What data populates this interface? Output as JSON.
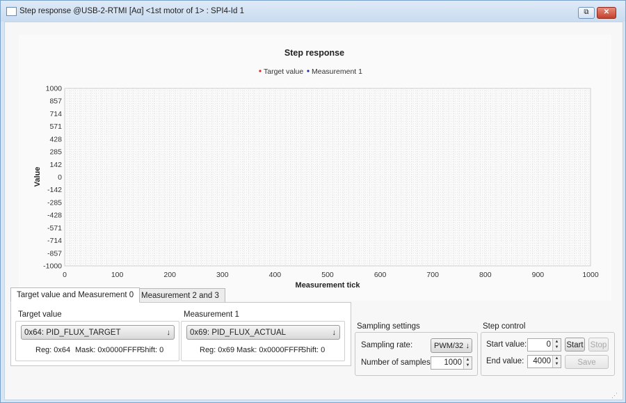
{
  "window": {
    "title": "Step response @USB-2-RTMI [Aα] <1st motor of 1> : SPI4-Id 1",
    "restore_glyph": "⧉",
    "close_glyph": "✕"
  },
  "chart_data": {
    "type": "line",
    "title": "Step response",
    "xlabel": "Measurement tick",
    "ylabel": "Value",
    "xlim": [
      0,
      1000
    ],
    "ylim": [
      -1000,
      1000
    ],
    "x_ticks": [
      "0",
      "100",
      "200",
      "300",
      "400",
      "500",
      "600",
      "700",
      "800",
      "900",
      "1000"
    ],
    "y_ticks": [
      "1000",
      "857",
      "714",
      "571",
      "428",
      "285",
      "142",
      "0",
      "-142",
      "-285",
      "-428",
      "-571",
      "-714",
      "-857",
      "-1000"
    ],
    "grid": true,
    "legend_position": "top-center",
    "series": [
      {
        "name": "Target value",
        "color": "#d62728",
        "values": []
      },
      {
        "name": "Measurement 1",
        "color": "#1f2f9f",
        "values": []
      }
    ]
  },
  "tabs": [
    {
      "label": "Target value and Measurement 0",
      "active": true
    },
    {
      "label": "Measurement 2 and 3",
      "active": false
    }
  ],
  "target": {
    "group_label": "Target value",
    "combo_value": "0x64: PID_FLUX_TARGET",
    "reg": "Reg: 0x64",
    "mask": "Mask: 0x0000FFFF",
    "shift": "Shift: 0"
  },
  "measurement": {
    "group_label": "Measurement 1",
    "combo_value": "0x69: PID_FLUX_ACTUAL",
    "reg": "Reg: 0x69",
    "mask": "Mask: 0x0000FFFF",
    "shift": "Shift: 0"
  },
  "sampling": {
    "group_label": "Sampling settings",
    "rate_label": "Sampling rate:",
    "rate_value": "PWM/32",
    "samples_label": "Number of samples:",
    "samples_value": "1000"
  },
  "step": {
    "group_label": "Step control",
    "start_label": "Start value:",
    "start_value": "0",
    "end_label": "End value:",
    "end_value": "4000",
    "start_button": "Start",
    "stop_button": "Stop",
    "save_button": "Save"
  },
  "icons": {
    "dropdown": "↓",
    "spin_up": "▲",
    "spin_down": "▼",
    "grip": "⋰"
  }
}
